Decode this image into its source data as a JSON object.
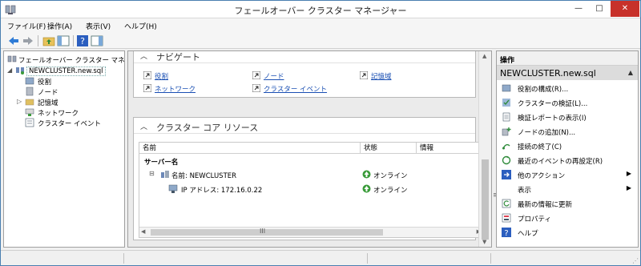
{
  "window": {
    "title": "フェールオーバー クラスター マネージャー",
    "min_label": "—",
    "max_label": "□",
    "close_label": "✕"
  },
  "menu": [
    "ファイル(F)",
    "操作(A)",
    "表示(V)",
    "ヘルプ(H)"
  ],
  "tree": {
    "root": "フェールオーバー クラスター マネージ",
    "cluster": "NEWCLUSTER.new.sql",
    "children": [
      "役割",
      "ノード",
      "記憶域",
      "ネットワーク",
      "クラスター イベント"
    ]
  },
  "center": {
    "navigate_title": "ナビゲート",
    "links": [
      "役割",
      "ノード",
      "記憶域",
      "ネットワーク",
      "クラスター イベント"
    ],
    "core_title": "クラスター コア リソース",
    "columns": [
      "名前",
      "状態",
      "情報"
    ],
    "group_header": "サーバー名",
    "rows": [
      {
        "name": "名前: NEWCLUSTER",
        "status": "オンライン",
        "expander": "⊟"
      },
      {
        "name": "IP アドレス: 172.16.0.22",
        "status": "オンライン",
        "expander": ""
      }
    ],
    "scroll_grip": "III",
    "splitter_grip": "≡"
  },
  "actions": {
    "header": "操作",
    "subheader": "NEWCLUSTER.new.sql",
    "items": [
      {
        "label": "役割の構成(R)...",
        "icon": "roles-icon",
        "submenu": ""
      },
      {
        "label": "クラスターの検証(L)...",
        "icon": "validate-icon",
        "submenu": ""
      },
      {
        "label": "検証レポートの表示(I)",
        "icon": "report-icon",
        "submenu": ""
      },
      {
        "label": "ノードの追加(N)...",
        "icon": "add-node-icon",
        "submenu": ""
      },
      {
        "label": "接続の終了(C)",
        "icon": "disconnect-icon",
        "submenu": ""
      },
      {
        "label": "最近のイベントの再設定(R)",
        "icon": "reset-events-icon",
        "submenu": ""
      },
      {
        "label": "他のアクション",
        "icon": "more-actions-icon",
        "submenu": "▶"
      },
      {
        "label": "表示",
        "icon": "",
        "submenu": "▶"
      },
      {
        "label": "最新の情報に更新",
        "icon": "refresh-icon",
        "submenu": ""
      },
      {
        "label": "プロパティ",
        "icon": "properties-icon",
        "submenu": ""
      },
      {
        "label": "ヘルプ",
        "icon": "help-icon",
        "submenu": ""
      }
    ]
  },
  "colors": {
    "online_green": "#3a9b3a",
    "link_blue": "#1a4fb3",
    "close_red": "#c7312a"
  }
}
